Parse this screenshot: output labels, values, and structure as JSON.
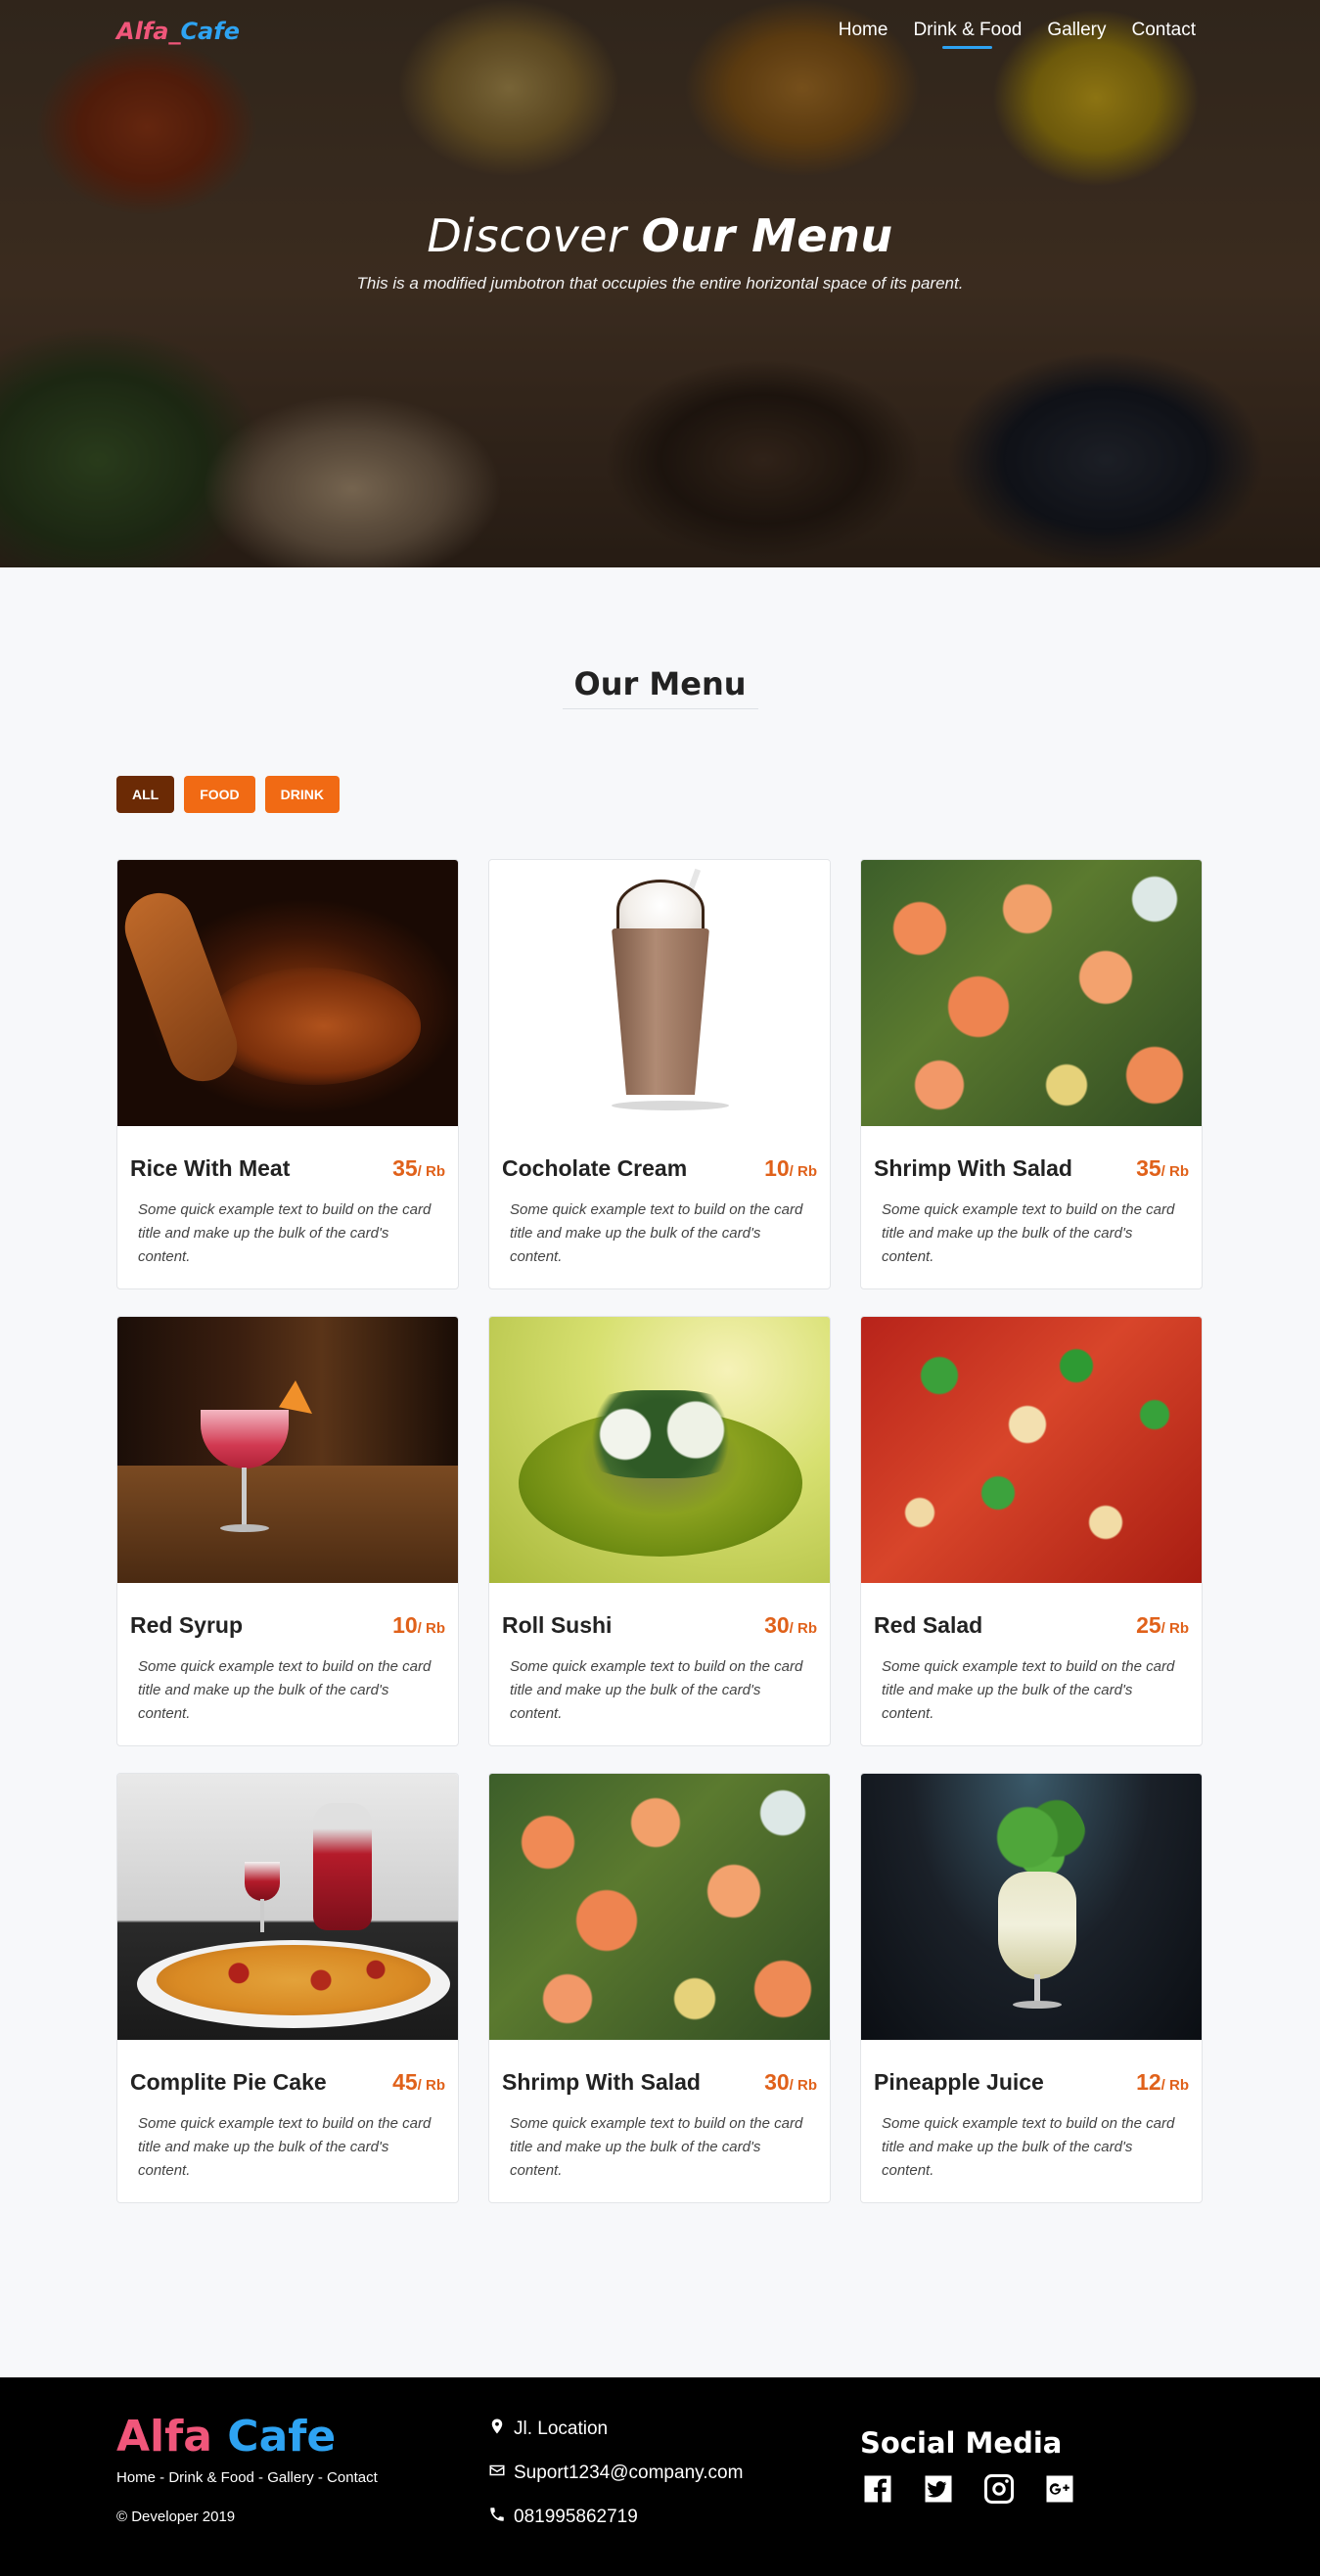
{
  "nav": {
    "brand_part1": "Alfa_",
    "brand_part2": "Cafe",
    "links": [
      "Home",
      "Drink & Food",
      "Gallery",
      "Contact"
    ],
    "active": "Drink & Food"
  },
  "hero": {
    "title_light": "Discover",
    "title_bold": "Our Menu",
    "subtitle": "This is a modified jumbotron that occupies the entire horizontal space of its parent."
  },
  "menu": {
    "heading": "Our Menu",
    "filters": [
      "ALL",
      "FOOD",
      "DRINK"
    ],
    "items": [
      {
        "title": "Rice With Meat",
        "price": "35",
        "unit": "/ Rb",
        "text": "Some quick example text to build on the card title and make up the bulk of the card's content."
      },
      {
        "title": "Cocholate Cream",
        "price": "10",
        "unit": "/ Rb",
        "text": "Some quick example text to build on the card title and make up the bulk of the card's content."
      },
      {
        "title": "Shrimp With Salad",
        "price": "35",
        "unit": "/ Rb",
        "text": "Some quick example text to build on the card title and make up the bulk of the card's content."
      },
      {
        "title": "Red Syrup",
        "price": "10",
        "unit": "/ Rb",
        "text": "Some quick example text to build on the card title and make up the bulk of the card's content."
      },
      {
        "title": "Roll Sushi",
        "price": "30",
        "unit": "/ Rb",
        "text": "Some quick example text to build on the card title and make up the bulk of the card's content."
      },
      {
        "title": "Red Salad",
        "price": "25",
        "unit": "/ Rb",
        "text": "Some quick example text to build on the card title and make up the bulk of the card's content."
      },
      {
        "title": "Complite Pie Cake",
        "price": "45",
        "unit": "/ Rb",
        "text": "Some quick example text to build on the card title and make up the bulk of the card's content."
      },
      {
        "title": "Shrimp With Salad",
        "price": "30",
        "unit": "/ Rb",
        "text": "Some quick example text to build on the card title and make up the bulk of the card's content."
      },
      {
        "title": "Pineapple Juice",
        "price": "12",
        "unit": "/ Rb",
        "text": "Some quick example text to build on the card title and make up the bulk of the card's content."
      }
    ]
  },
  "footer": {
    "brand_part1": "Alfa",
    "brand_part2": "Cafe",
    "links": "Home - Drink & Food - Gallery - Contact",
    "copyright": "© Developer 2019",
    "location": "Jl. Location",
    "email": "Suport1234@company.com",
    "phone": "081995862719",
    "social_title": "Social Media",
    "social_icons": [
      "facebook-icon",
      "twitter-icon",
      "instagram-icon",
      "google-plus-icon"
    ]
  },
  "colors": {
    "brand_pink": "#f0567a",
    "brand_blue": "#2ea3f2",
    "price_orange": "#e0611a",
    "filter_all": "#6b2a05",
    "filter_other": "#f16a14",
    "footer_bg": "#000000"
  }
}
